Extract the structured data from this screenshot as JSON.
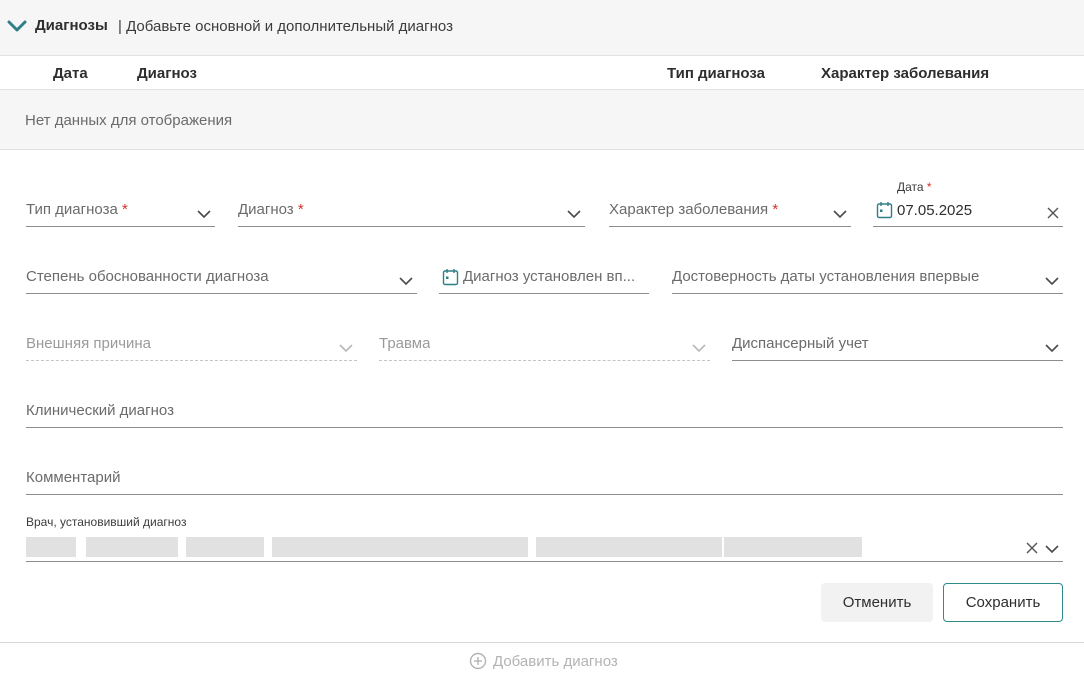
{
  "header": {
    "title": "Диагнозы",
    "subtitle": "| Добавьте основной и дополнительный диагноз"
  },
  "table": {
    "columns": [
      "Дата",
      "Диагноз",
      "Тип диагноза",
      "Характер заболевания"
    ],
    "empty_text": "Нет данных для отображения"
  },
  "form": {
    "diagnosis_type": {
      "label": "Тип диагноза",
      "required": "*"
    },
    "diagnosis": {
      "label": "Диагноз",
      "required": "*"
    },
    "disease_nature": {
      "label": "Характер заболевания",
      "required": "*"
    },
    "date": {
      "label": "Дата",
      "required": "*",
      "value": "07.05.2025"
    },
    "validity_degree": {
      "label": "Степень обоснованности диагноза"
    },
    "first_established": {
      "label": "Диагноз установлен вп..."
    },
    "first_date_reliability": {
      "label": "Достоверность даты установления впервые"
    },
    "external_cause": {
      "label": "Внешняя причина"
    },
    "trauma": {
      "label": "Травма"
    },
    "dispensary": {
      "label": "Диспансерный учет"
    },
    "clinical_diagnosis": {
      "label": "Клинический диагноз"
    },
    "comment": {
      "label": "Комментарий"
    },
    "doctor": {
      "label": "Врач, установивший диагноз"
    }
  },
  "buttons": {
    "cancel": "Отменить",
    "save": "Сохранить",
    "add_diagnosis": "Добавить диагноз"
  },
  "colors": {
    "accent": "#2f8b8b",
    "required": "#d0342c",
    "header_bg": "#f6f6f6"
  },
  "icons": [
    "chevron-down-icon",
    "calendar-icon",
    "close-icon",
    "plus-circle-icon"
  ]
}
